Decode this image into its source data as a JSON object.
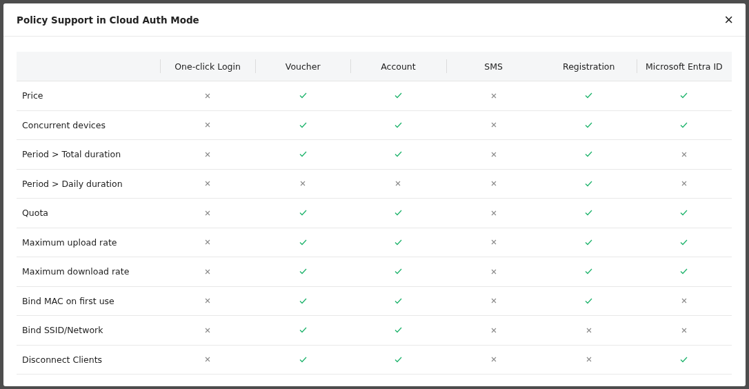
{
  "dialog": {
    "title": "Policy Support in Cloud Auth Mode",
    "close": "×"
  },
  "table": {
    "columns": [
      "One-click Login",
      "Voucher",
      "Account",
      "SMS",
      "Registration",
      "Microsoft Entra ID"
    ],
    "rows": [
      {
        "policy": "Price",
        "supported": [
          false,
          true,
          true,
          false,
          true,
          true
        ]
      },
      {
        "policy": "Concurrent devices",
        "supported": [
          false,
          true,
          true,
          false,
          true,
          true
        ]
      },
      {
        "policy": "Period > Total duration",
        "supported": [
          false,
          true,
          true,
          false,
          true,
          false
        ]
      },
      {
        "policy": "Period > Daily duration",
        "supported": [
          false,
          false,
          false,
          false,
          true,
          false
        ]
      },
      {
        "policy": "Quota",
        "supported": [
          false,
          true,
          true,
          false,
          true,
          true
        ]
      },
      {
        "policy": "Maximum upload rate",
        "supported": [
          false,
          true,
          true,
          false,
          true,
          true
        ]
      },
      {
        "policy": "Maximum download rate",
        "supported": [
          false,
          true,
          true,
          false,
          true,
          true
        ]
      },
      {
        "policy": "Bind MAC on first use",
        "supported": [
          false,
          true,
          true,
          false,
          true,
          false
        ]
      },
      {
        "policy": "Bind SSID/Network",
        "supported": [
          false,
          true,
          true,
          false,
          false,
          false
        ]
      },
      {
        "policy": "Disconnect Clients",
        "supported": [
          false,
          true,
          true,
          false,
          false,
          true
        ]
      }
    ]
  }
}
